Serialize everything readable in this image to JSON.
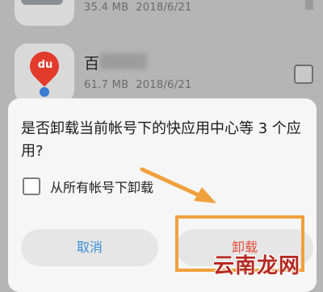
{
  "app_list": [
    {
      "name": "",
      "size": "35.4 MB",
      "date": "2018/6/21",
      "icon": "photo-app-icon"
    },
    {
      "name": "百",
      "size": "61.7 MB",
      "date": "2018/6/21",
      "icon": "baidu-map-icon",
      "icon_text": "du"
    }
  ],
  "dialog": {
    "message": "是否卸载当前帐号下的快应用中心等 3 个应用?",
    "option_label": "从所有帐号下卸载",
    "option_checked": false,
    "cancel_label": "取消",
    "confirm_label": "卸载"
  },
  "colors": {
    "highlight": "#f0a03c",
    "cancel_text": "#3a8fd6",
    "confirm_text": "#e64b3b"
  },
  "watermark": "云南龙网"
}
